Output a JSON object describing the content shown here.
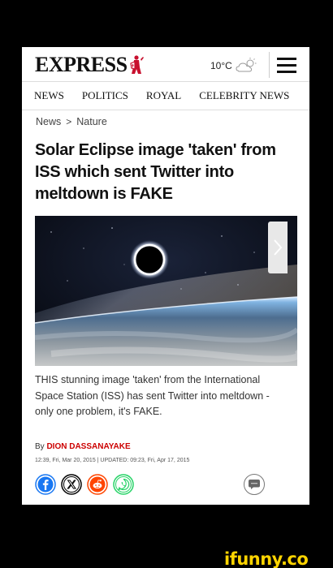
{
  "header": {
    "logo_text": "EXPRESS",
    "temperature": "10°C",
    "weather_icon": "partly-cloudy-icon",
    "menu_icon": "hamburger-menu-icon"
  },
  "nav": {
    "items": [
      "NEWS",
      "POLITICS",
      "ROYAL",
      "CELEBRITY NEWS"
    ]
  },
  "breadcrumb": {
    "parent": "News",
    "separator": ">",
    "current": "Nature"
  },
  "article": {
    "headline": "Solar Eclipse image 'taken' from ISS which sent Twitter into meltdown is FAKE",
    "image_alt": "Solar eclipse over Earth seen from space",
    "summary": "THIS stunning image 'taken' from the International Space Station (ISS) has sent Twitter into meltdown - only one problem, it's FAKE.",
    "by_label": "By",
    "author": "DION DASSANAYAKE",
    "dateline": "12:39, Fri, Mar 20, 2015 | UPDATED: 09:23, Fri, Apr 17, 2015"
  },
  "share": {
    "buttons": [
      {
        "name": "facebook",
        "color": "#1877f2"
      },
      {
        "name": "x",
        "color": "#000000"
      },
      {
        "name": "reddit",
        "color": "#ff4500"
      },
      {
        "name": "whatsapp",
        "color": "#25d366"
      }
    ],
    "comment_icon": "comment-bubble-icon"
  },
  "watermark": "ifunny.co",
  "colors": {
    "author_red": "#cc0000",
    "background": "#000000"
  }
}
